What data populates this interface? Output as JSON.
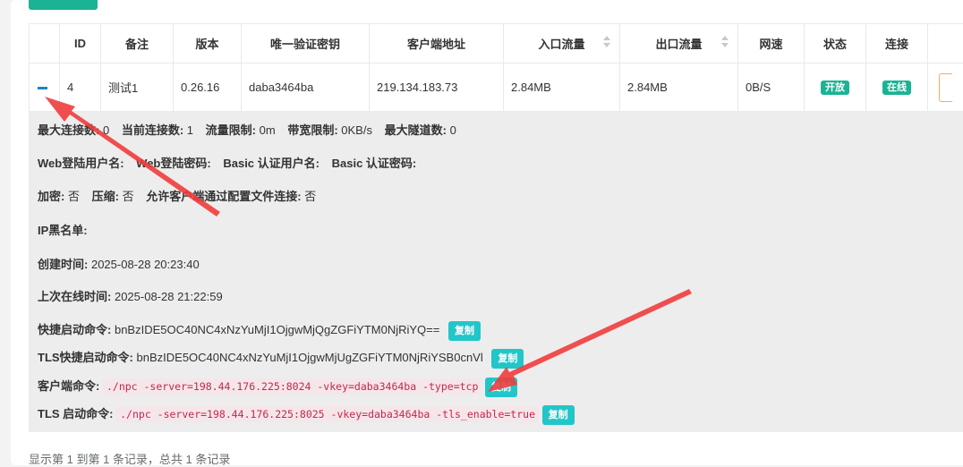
{
  "table": {
    "headers": {
      "id": "ID",
      "remark": "备注",
      "version": "版本",
      "vkey": "唯一验证密钥",
      "address": "客户端地址",
      "in_flow": "入口流量",
      "out_flow": "出口流量",
      "speed": "网速",
      "status": "状态",
      "connect": "连接"
    },
    "row": {
      "id": "4",
      "remark": "测试1",
      "version": "0.26.16",
      "vkey": "daba3464ba",
      "address": "219.134.183.73",
      "in_flow": "2.84MB",
      "out_flow": "2.84MB",
      "speed": "0B/S",
      "status": "开放",
      "connect": "在线"
    }
  },
  "detail": {
    "max_conn_label": "最大连接数:",
    "max_conn_value": "0",
    "cur_conn_label": "当前连接数:",
    "cur_conn_value": "1",
    "flow_limit_label": "流量限制:",
    "flow_limit_value": "0m",
    "rate_limit_label": "带宽限制:",
    "rate_limit_value": "0KB/s",
    "max_tunnel_label": "最大隧道数:",
    "max_tunnel_value": "0",
    "web_user_label": "Web登陆用户名:",
    "web_pass_label": "Web登陆密码:",
    "basic_user_label": "Basic 认证用户名:",
    "basic_pass_label": "Basic 认证密码:",
    "crypt_label": "加密:",
    "crypt_value": "否",
    "compress_label": "压缩:",
    "compress_value": "否",
    "config_conn_label": "允许客户端通过配置文件连接:",
    "config_conn_value": "否",
    "ip_black_label": "IP黑名单:",
    "create_time_label": "创建时间:",
    "create_time_value": "2025-08-28 20:23:40",
    "last_online_label": "上次在线时间:",
    "last_online_value": "2025-08-28 21:22:59",
    "quick_cmd_label": "快捷启动命令:",
    "quick_cmd_value": "bnBzIDE5OC40NC4xNzYuMjI1OjgwMjQgZGFiYTM0NjRiYQ==",
    "tls_quick_cmd_label": "TLS快捷启动命令:",
    "tls_quick_cmd_value": "bnBzIDE5OC40NC4xNzYuMjI1OjgwMjUgZGFiYTM0NjRiYSB0cnVl",
    "client_cmd_label": "客户端命令:",
    "client_cmd_value": "./npc -server=198.44.176.225:8024 -vkey=daba3464ba -type=tcp",
    "tls_cmd_label": "TLS 启动命令:",
    "tls_cmd_value": "./npc -server=198.44.176.225:8025 -vkey=daba3464ba -tls_enable=true",
    "copy_label": "复制"
  },
  "footer": {
    "summary": "显示第 1 到第 1 条记录，总共 1 条记录"
  },
  "colors": {
    "primary": "#1ab394",
    "info": "#23c6c8",
    "link": "#1c84c6",
    "code_text": "#c7254e",
    "annotation_arrow": "#f03c3c"
  }
}
